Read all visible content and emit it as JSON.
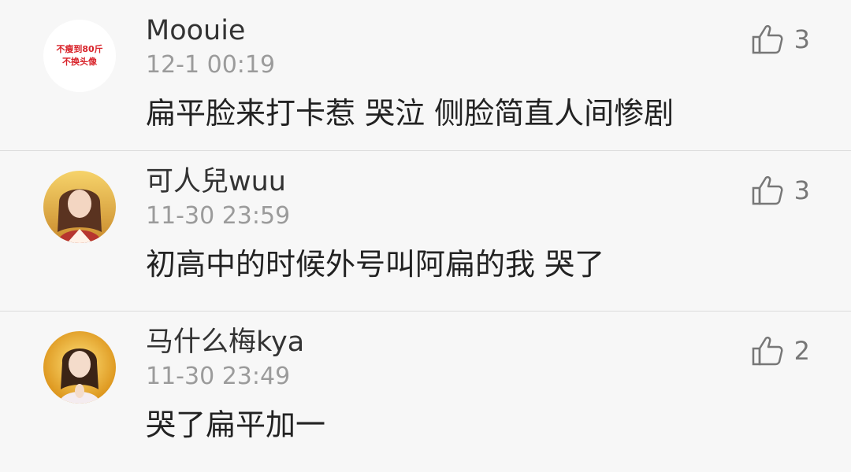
{
  "comments": [
    {
      "username": "Moouie",
      "timestamp": "12-1 00:19",
      "content": "扁平脸来打卡惹 哭泣 侧脸简直人间惨剧",
      "likes": "3",
      "avatar": {
        "type": "text",
        "lines": [
          "不瘦到80斤",
          "不换头像"
        ]
      }
    },
    {
      "username": "可人兒wuu",
      "timestamp": "11-30 23:59",
      "content": "初高中的时候外号叫阿扁的我 哭了",
      "likes": "3",
      "avatar": {
        "type": "photo",
        "colors": [
          "#f0c33f",
          "#7a4b2b"
        ]
      }
    },
    {
      "username": "马什么梅kya",
      "timestamp": "11-30 23:49",
      "content": "哭了扁平加一",
      "likes": "2",
      "avatar": {
        "type": "photo",
        "colors": [
          "#f2b31b",
          "#3b2416"
        ]
      }
    }
  ],
  "icons": {
    "like": "thumbs-up-icon"
  }
}
